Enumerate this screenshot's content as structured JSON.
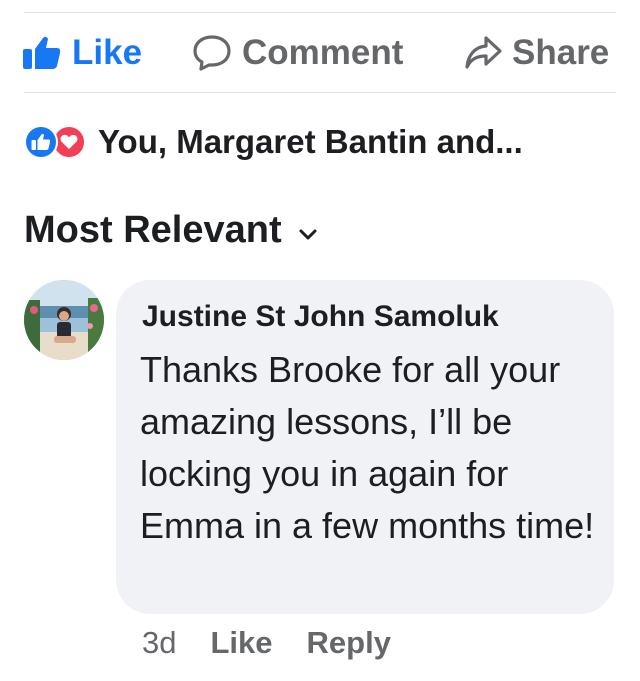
{
  "actions": {
    "like_label": "Like",
    "comment_label": "Comment",
    "share_label": "Share"
  },
  "reactions": {
    "summary": "You, Margaret Bantin and...",
    "icons": [
      "thumbs-up-reaction",
      "heart-reaction"
    ]
  },
  "sort": {
    "label": "Most Relevant"
  },
  "comment": {
    "author": "Justine St John Samoluk",
    "text": "Thanks Brooke for all your amazing lessons, I’ll be locking you in again for Emma in a few months time!",
    "time": "3d",
    "like_label": "Like",
    "reply_label": "Reply"
  },
  "colors": {
    "like_blue": "#1877f2",
    "love_red": "#f33e58",
    "secondary_text": "#65676b",
    "bubble_bg": "#f0f2f5"
  }
}
